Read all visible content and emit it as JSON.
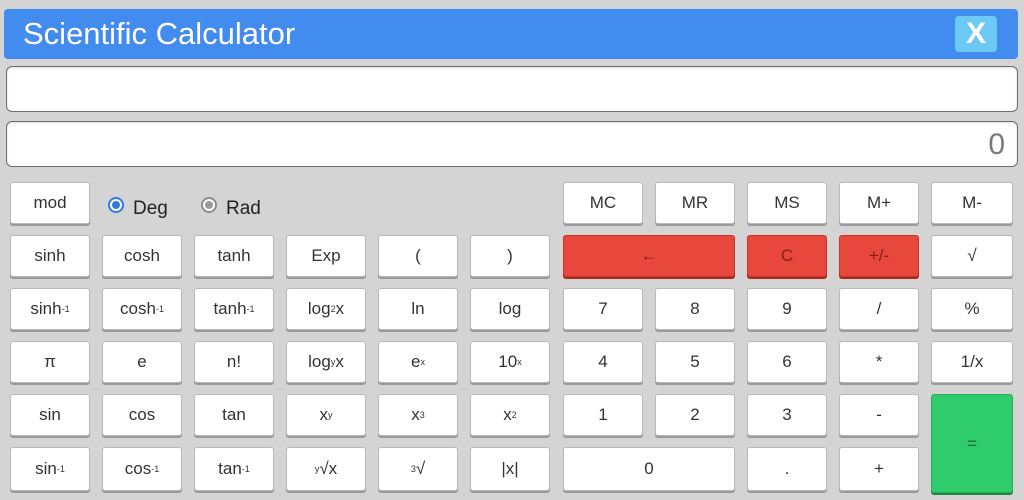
{
  "window": {
    "title": "Scientific Calculator",
    "close_label": "X"
  },
  "display": {
    "expression": "",
    "result": "0"
  },
  "mode": {
    "selected": "Deg",
    "deg_label": "Deg",
    "rad_label": "Rad"
  },
  "colors": {
    "titlebar": "#428bef",
    "close": "#6cc8f5",
    "danger": "#e8473c",
    "equals": "#2ecc6b"
  },
  "buttons": {
    "mod": "mod",
    "sinh": "sinh",
    "cosh": "cosh",
    "tanh": "tanh",
    "exp": "Exp",
    "paren_open": "(",
    "paren_close": ")",
    "sinh_base": "sinh",
    "cosh_base": "cosh",
    "tanh_base": "tanh",
    "inverse_exp": "-1",
    "log2_base": "log",
    "log2_sub": "2",
    "log2_x": "x",
    "ln": "ln",
    "log": "log",
    "pi": "π",
    "e": "e",
    "factorial": "n!",
    "logy_base": "log",
    "logy_sub": "y",
    "logy_x": "x",
    "e_pow_base": "e",
    "e_pow_sup": "x",
    "ten_pow_base": "10",
    "ten_pow_sup": "x",
    "sin": "sin",
    "cos": "cos",
    "tan": "tan",
    "x_pow_base": "x",
    "x_pow_sup": "y",
    "x_cube_base": "x",
    "x_cube_sup": "3",
    "x_sq_base": "x",
    "x_sq_sup": "2",
    "sin_base": "sin",
    "cos_base": "cos",
    "tan_base": "tan",
    "yroot_sup": "y",
    "yroot_base": "√x",
    "cuberoot_sup": "3",
    "cuberoot_base": "√",
    "abs": "|x|",
    "mc": "MC",
    "mr": "MR",
    "ms": "MS",
    "mplus": "M+",
    "mminus": "M-",
    "backspace": "←",
    "clear": "C",
    "negate": "+/-",
    "sqrt": "√",
    "d7": "7",
    "d8": "8",
    "d9": "9",
    "divide": "/",
    "percent": "%",
    "d4": "4",
    "d5": "5",
    "d6": "6",
    "multiply": "*",
    "reciprocal": "1/x",
    "d1": "1",
    "d2": "2",
    "d3": "3",
    "minus": "-",
    "equals": "=",
    "d0": "0",
    "decimal": ".",
    "plus": "+"
  }
}
